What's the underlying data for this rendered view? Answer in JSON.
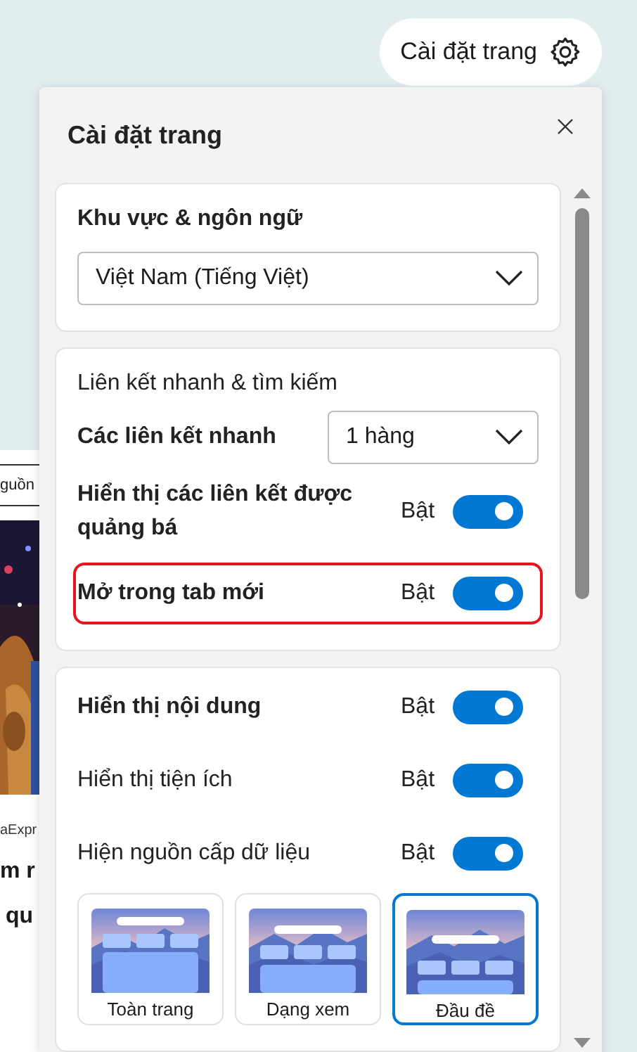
{
  "header_button": {
    "label": "Cài đặt trang"
  },
  "background_page": {
    "texts": [
      "guồn",
      "aExpr"
    ],
    "headline_lines": [
      "m r",
      "qu"
    ]
  },
  "panel": {
    "title": "Cài đặt trang",
    "region": {
      "title": "Khu vực & ngôn ngữ",
      "dropdown": "Việt Nam (Tiếng Việt)"
    },
    "quick_links": {
      "title": "Liên kết nhanh & tìm kiếm",
      "dropdown_label": "Các liên kết nhanh",
      "dropdown": "1 hàng",
      "toggles": [
        {
          "label": "Hiển thị các liên kết được quảng bá",
          "state_label": "Bật",
          "on": true,
          "highlighted": false
        },
        {
          "label": "Mở trong tab mới",
          "state_label": "Bật",
          "on": true,
          "highlighted": true
        }
      ]
    },
    "content": {
      "toggles": [
        {
          "label": "Hiển thị nội dung",
          "state_label": "Bật",
          "on": true,
          "bold": true
        },
        {
          "label": "Hiển thị tiện ích",
          "state_label": "Bật",
          "on": true,
          "bold": false
        },
        {
          "label": "Hiện nguồn cấp dữ liệu",
          "state_label": "Bật",
          "on": true,
          "bold": false
        }
      ],
      "layouts": [
        {
          "kind": "full",
          "label": "Toàn trang",
          "selected": false
        },
        {
          "kind": "view",
          "label": "Dạng xem",
          "selected": false
        },
        {
          "kind": "headline",
          "label": "Đầu đề",
          "selected": true
        }
      ]
    }
  }
}
